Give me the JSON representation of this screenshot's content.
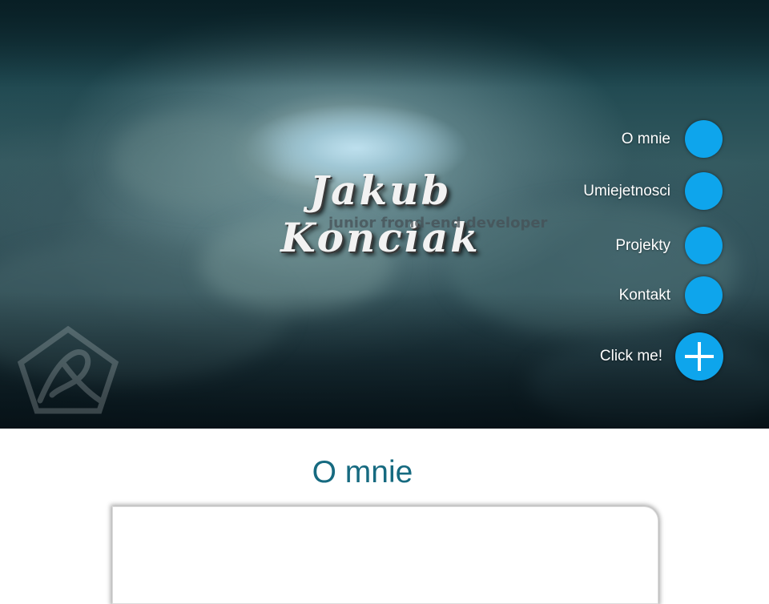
{
  "brand": {
    "name": "Jakub Konciak",
    "subtitle": "junior frond-end developer"
  },
  "nav": {
    "items": [
      {
        "label": "O mnie"
      },
      {
        "label": "Umiejetnosci"
      },
      {
        "label": "Projekty"
      },
      {
        "label": "Kontakt"
      }
    ],
    "cta_label": "Click me!"
  },
  "section": {
    "title": "O mnie"
  },
  "colors": {
    "accent": "#0ea5ec",
    "heading": "#166a80"
  },
  "icons": {
    "logo": "pentagon-logo-icon",
    "cta": "plus-icon"
  }
}
